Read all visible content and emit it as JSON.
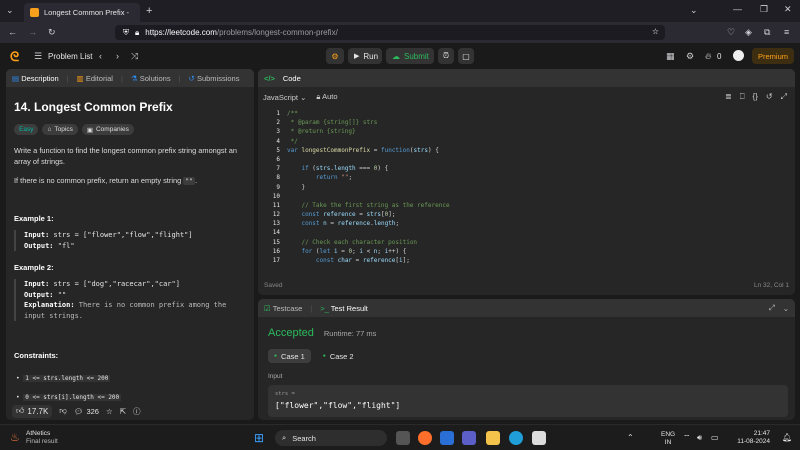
{
  "browser": {
    "tab_title": "Longest Common Prefix - Leet",
    "url_domain": "https://leetcode.com",
    "url_path": "/problems/longest-common-prefix/"
  },
  "toolbar": {
    "problem_list": "Problem List",
    "run": "Run",
    "submit": "Submit",
    "streak": "0",
    "premium": "Premium"
  },
  "left_panel": {
    "tabs": [
      "Description",
      "Editorial",
      "Solutions",
      "Submissions"
    ],
    "title": "14. Longest Common Prefix",
    "difficulty": "Easy",
    "topics": "Topics",
    "companies": "Companies",
    "para1": "Write a function to find the longest common prefix string amongst an array of strings.",
    "para2_prefix": "If there is no common prefix, return an empty string ",
    "para2_code": "\"\"",
    "para2_suffix": ".",
    "example1_title": "Example 1:",
    "example1_input_label": "Input:",
    "example1_input": "strs = [\"flower\",\"flow\",\"flight\"]",
    "example1_output_label": "Output:",
    "example1_output": "\"fl\"",
    "example2_title": "Example 2:",
    "example2_input_label": "Input:",
    "example2_input": "strs = [\"dog\",\"racecar\",\"car\"]",
    "example2_output_label": "Output:",
    "example2_output": "\"\"",
    "example2_expl_label": "Explanation:",
    "example2_expl": "There is no common prefix among the input strings.",
    "constraints_title": "Constraints:",
    "constraint1": "1 <= strs.length <= 200",
    "constraint2": "0 <= strs[i].length <= 200",
    "likes": "17.7K",
    "comments": "326"
  },
  "code_panel": {
    "title": "Code",
    "language": "JavaScript",
    "mode": "Auto",
    "saved": "Saved",
    "cursor": "Ln 32, Col 1",
    "lines": [
      "1",
      "2",
      "3",
      "4",
      "5",
      "6",
      "7",
      "8",
      "9",
      "10",
      "11",
      "12",
      "13",
      "14",
      "15",
      "16",
      "17"
    ]
  },
  "result_panel": {
    "tab_testcase": "Testcase",
    "tab_result": "Test Result",
    "status": "Accepted",
    "runtime": "Runtime: 77 ms",
    "case1": "Case 1",
    "case2": "Case 2",
    "input_label": "Input",
    "var_label": "strs =",
    "var_value": "[\"flower\",\"flow\",\"flight\"]"
  },
  "taskbar": {
    "app_name": "AtNetics",
    "app_sub": "Final result",
    "search": "Search",
    "lang1": "ENG",
    "lang2": "IN",
    "time": "21:47",
    "date": "11-08-2024"
  },
  "colors": {
    "accepted": "#2cbb5d",
    "submit": "#2cbb5d",
    "premium": "#ffa116",
    "easy": "#00b8a3"
  }
}
